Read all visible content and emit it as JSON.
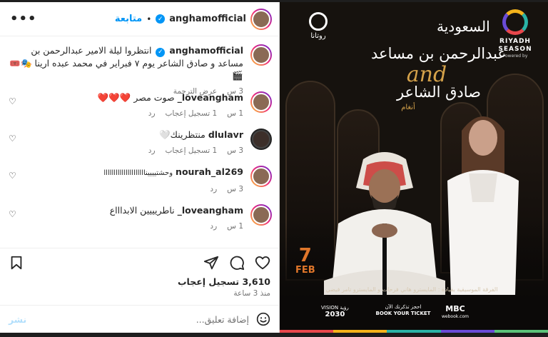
{
  "header": {
    "more_label": "•••",
    "follow_label": "متابعة",
    "dot": "•",
    "username": "anghamofficial",
    "verified_mark": "✓"
  },
  "caption": {
    "username": "anghamofficial",
    "text": "انتظروا ليلة الامير عبدالرحمن بن مساعد و صادق الشاعر يوم ٧ فبراير في محمد عبده ارينا 🎭🎟️🎬",
    "time": "3 س",
    "see_translation": "عرض الترجمة"
  },
  "comments": [
    {
      "username": "_loveangham",
      "text": "صوت مصر ❤️❤️❤️",
      "time": "1 س",
      "likes": "1 تسجيل إعجاب",
      "reply": "رد"
    },
    {
      "username": "dlulavr",
      "text": "منتظرينك🤍",
      "time": "3 س",
      "likes": "1 تسجيل إعجاب",
      "reply": "رد"
    },
    {
      "username": "nourah_al269",
      "text": "وحشتيييينااااااااااااااااااااا",
      "time": "3 س",
      "likes": "",
      "reply": "رد"
    },
    {
      "username": "_loveangham",
      "text": "ناطريييين الابداااع",
      "time": "1 س",
      "likes": "",
      "reply": "رد"
    }
  ],
  "actions": {
    "likes_count": "3,610 تسجيل إعجاب",
    "posted_ago": "منذ 3 ساعة"
  },
  "compose": {
    "post_label": "نشر",
    "placeholder": "إضافة تعليق..."
  },
  "poster": {
    "riyadh_season_line1": "RIYADH",
    "riyadh_season_line2": "SEASON",
    "riyadh_powered": "Powered by",
    "saudi_logo_text": "السعودية",
    "rotana_text": "روتانا",
    "name1": "عبدالرحمن بن مساعد",
    "and_text": "and",
    "name2": "صادق الشاعر",
    "angham_text": "أنغام",
    "date_day": "7",
    "date_month": "FEB",
    "credits": "الفرقة الموسيقية بقيادة : المايسترو هاني فرحات و المايسترو تامر فيضي",
    "book_line1": "احجز تذكرتك الآن",
    "book_line2": "BOOK YOUR TICKET",
    "mbc": "MBC",
    "webook": "webook.com",
    "vision_line1": "VISION رؤية",
    "vision_line2": "2030",
    "colors": {
      "riyadh_ring": [
        "#f3b31b",
        "#2ab3a6",
        "#e8474c",
        "#6a4bd6"
      ],
      "date": "#e0762a",
      "accent_gold": "#d5a24a"
    }
  },
  "colors": {
    "follow_blue": "#0095f6",
    "text": "#262626",
    "muted": "#737373",
    "post_disabled": "#b2dffc",
    "heart_red": "#ed4956"
  }
}
